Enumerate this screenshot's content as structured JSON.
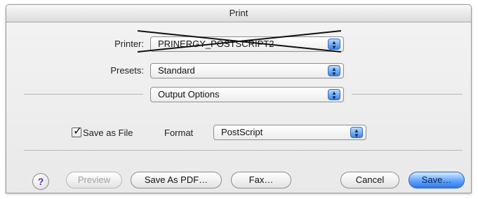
{
  "window": {
    "title": "Print"
  },
  "printer": {
    "label": "Printer:",
    "value": "PRINERGY_POSTSCRIPT2"
  },
  "presets": {
    "label": "Presets:",
    "value": "Standard"
  },
  "panel": {
    "value": "Output Options"
  },
  "options": {
    "save_as_file_label": "Save as File",
    "save_as_file_checked": true,
    "format_label": "Format",
    "format_value": "PostScript"
  },
  "buttons": {
    "help": "?",
    "preview": "Preview",
    "save_as_pdf": "Save As PDF…",
    "fax": "Fax…",
    "cancel": "Cancel",
    "save": "Save…"
  }
}
